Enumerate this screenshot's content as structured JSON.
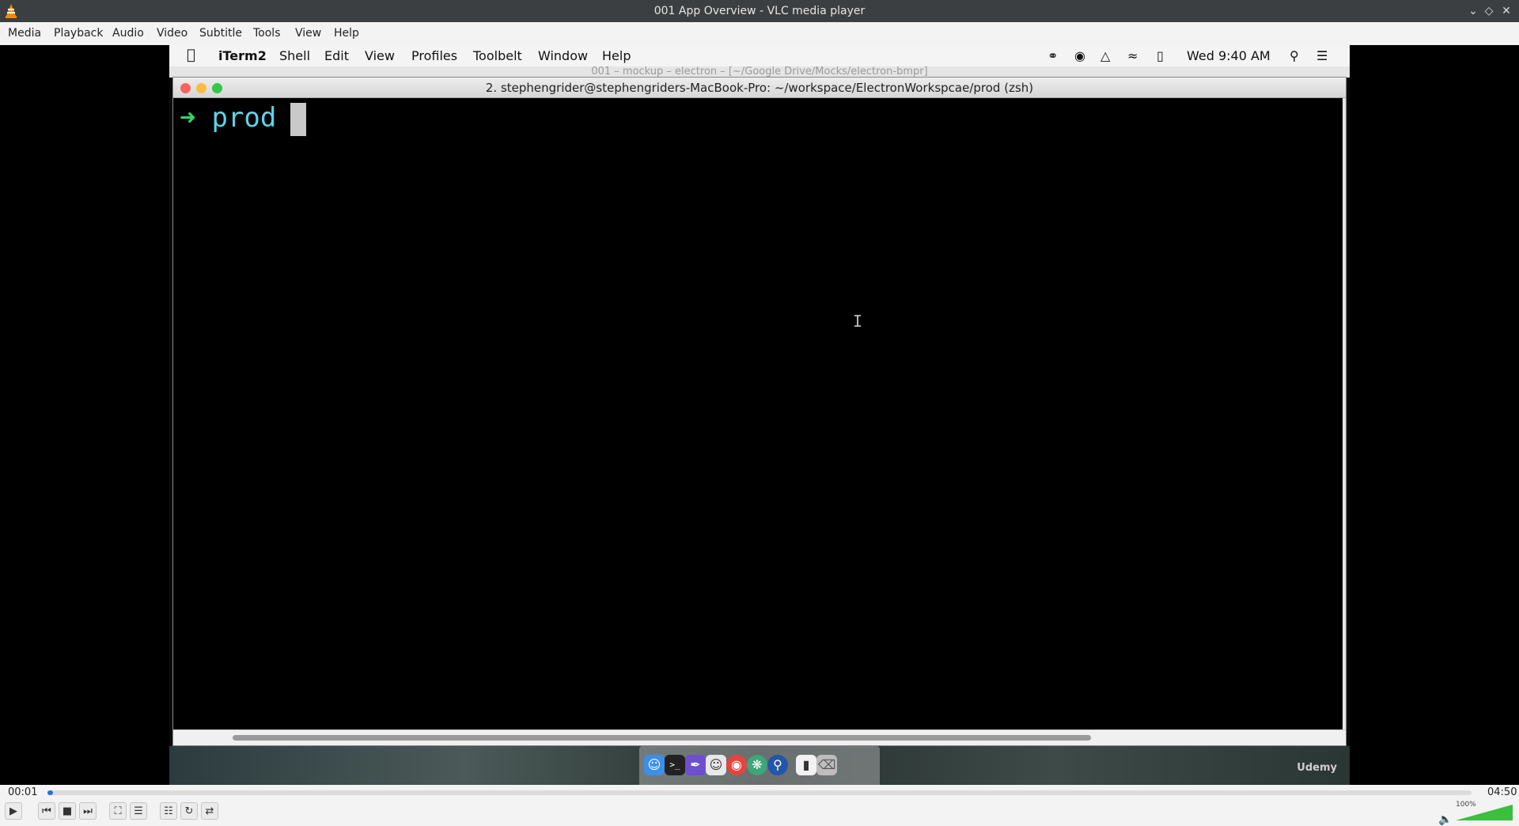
{
  "window": {
    "title": "001 App Overview - VLC media player"
  },
  "menu": [
    "Media",
    "Playback",
    "Audio",
    "Video",
    "Subtitle",
    "Tools",
    "View",
    "Help"
  ],
  "mac_menubar": {
    "items": [
      "iTerm2",
      "Shell",
      "Edit",
      "View",
      "Profiles",
      "Toolbelt",
      "Window",
      "Help"
    ],
    "clock": "Wed 9:40 AM"
  },
  "ghost_window_title": "001 – mockup – electron – [~/Google Drive/Mocks/electron-bmpr]",
  "iterm": {
    "title": "2. stephengrider@stephengriders-MacBook-Pro: ~/workspace/ElectronWorkspcae/prod (zsh)",
    "prompt_arrow": "➜",
    "prompt_dir": "prod"
  },
  "dock_icons": [
    "finder-icon",
    "terminal-icon",
    "quill-icon",
    "emoji-icon",
    "chrome-icon",
    "network-icon",
    "browser-icon",
    "file-icon",
    "trash-icon"
  ],
  "watermark": "Udemy",
  "player": {
    "elapsed": "00:01",
    "total": "04:50",
    "progress": 0.0034,
    "volume_label": "100%",
    "volume": 1.0
  },
  "colors": {
    "accent": "#2b72d6",
    "prompt_arrow": "#36d36a",
    "prompt_dir": "#5fd2e8"
  }
}
